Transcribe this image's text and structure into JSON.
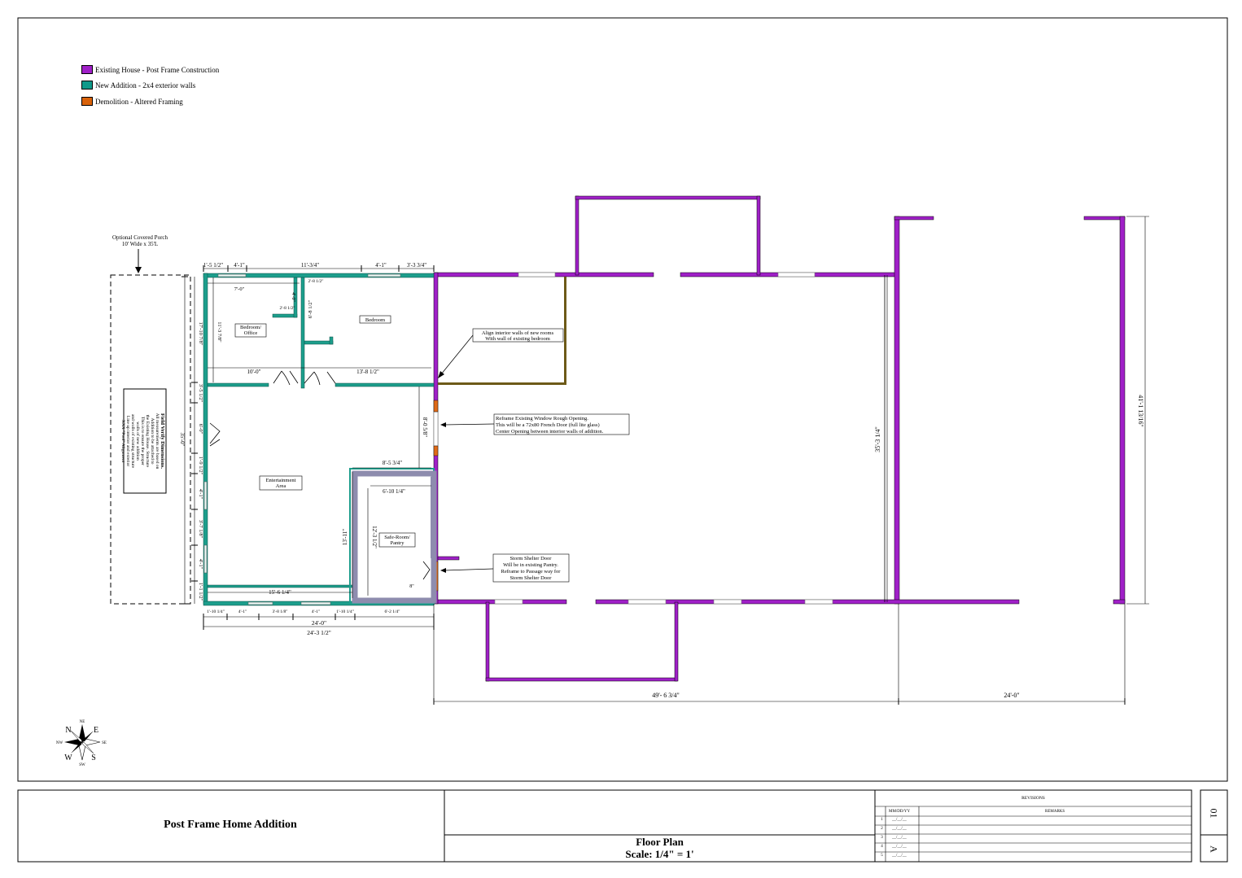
{
  "legend": [
    {
      "label": "Existing House - Post Frame Construction",
      "color": "#a020c8"
    },
    {
      "label": "New Addition - 2x4 exterior walls",
      "color": "#0f9a8a"
    },
    {
      "label": "Demolition - Altered Framing",
      "color": "#d9620a"
    }
  ],
  "colors": {
    "existing": "#a020c8",
    "addition": "#1d9e8c",
    "demolition": "#de6a17",
    "saferoom": "#8e8cae",
    "aligned_wall": "#6d5a18"
  },
  "porch": {
    "line1": "Optional Covered Porch",
    "line2": "10' Wide x 35'L"
  },
  "field_note": [
    "Field Verify Dimensions.",
    "All measurements are based on",
    "Addition to be attached to",
    "the Existing House. Structure",
    "This is to ensure the proper",
    "walls of new addition",
    "and walls of existing structure",
    "Line up interior and exterior",
    "XXX \"Pool\" Alignment"
  ],
  "rooms": {
    "bedroom_office": [
      "Bedroom/",
      "Office"
    ],
    "bedroom": "Bedroom",
    "entertainment": [
      "Entertainment",
      "Area"
    ],
    "safe_room": [
      "Safe-Room/",
      "Pantry"
    ]
  },
  "callouts": {
    "align": [
      "Align interior walls of new rooms",
      "With wall of existing bedroom"
    ],
    "reframe": [
      "Reframe Existing Window Rough Opening.",
      "This will be a 72x80 French Door (full lite glass)",
      "Center Opening between interior walls of addition."
    ],
    "storm": [
      "Storm Shelter Door",
      "Will be in existing Pantry.",
      "Reframe to Passage way for",
      "Storm Shelter Door"
    ]
  },
  "dims": {
    "top": [
      "1'-5 1/2\"",
      "4'-1\"",
      "11'-3/4\"",
      "4'-1\"",
      "3'-3 3/4\""
    ],
    "inner": [
      "7'-0\"",
      "4'-0\"",
      "2'-8 1/2\"",
      "2'-8 1/2\"",
      "6'-8 1/2\"",
      "11'-3 7/8\"",
      "10'-0\"",
      "13'-8 1/2\"",
      "8'-5 3/4\"",
      "6'-10 1/4\"",
      "12'-3 1/2\"",
      "13'-11\"",
      "15'-6 1/4\"",
      "8'-0 5/8\"",
      "8\""
    ],
    "left": [
      "17'-10 7/8\"",
      "3'-5 1/2\"",
      "6'-0\"",
      "1'-9 1/2\"",
      "4'-1\"",
      "3'-7 1/8\"",
      "4'-1\"",
      "1'-1 1/2\"",
      "35'-0\""
    ],
    "bottom": [
      "1'-10 1/4\"",
      "4'-1\"",
      "3'-8 1/8\"",
      "4'-1\"",
      "1'-10 1/4\"",
      "6'-2 1/4\"",
      "24'-0\"",
      "24'-3 1/2\""
    ],
    "overall": [
      "35'-3 1/4\"",
      "41'-1 13/16\"",
      "49'- 6 3/4\"",
      "24'-0\""
    ]
  },
  "compass": {
    "n": "N",
    "e": "E",
    "s": "S",
    "w": "W",
    "ne": "NE",
    "nw": "NW",
    "se": "SE",
    "sw": "SW"
  },
  "title_block": {
    "project": "Post Frame Home Addition",
    "sheet_title": "Floor Plan",
    "scale": "Scale: 1/4\" = 1'",
    "revisions_label": "REVISIONS",
    "rev_date_col": "MM/DD/YY",
    "rev_remarks_col": "REMARKS",
    "rev_rows": [
      {
        "num": "1",
        "date": "__/__/__"
      },
      {
        "num": "2",
        "date": "__/__/__"
      },
      {
        "num": "3",
        "date": "__/__/__"
      },
      {
        "num": "4",
        "date": "__/__/__"
      },
      {
        "num": "5",
        "date": "__/__/__"
      }
    ],
    "sheet_num": "01",
    "sheet_letter": "A"
  }
}
